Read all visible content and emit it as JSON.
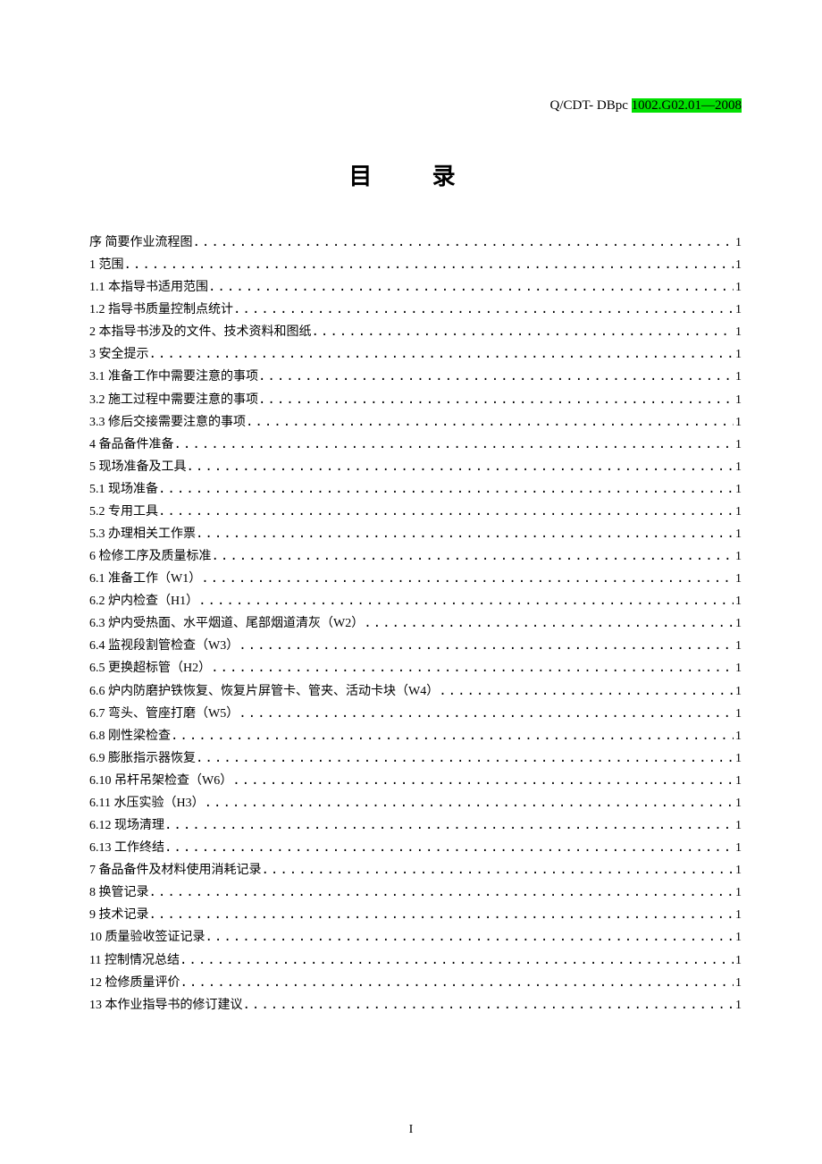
{
  "doc_code": {
    "prefix": "Q/CDT- DBpc ",
    "highlighted": "1002.G02.01—2008"
  },
  "title": "目 录",
  "page_number": "I",
  "toc": [
    {
      "label": "序  简要作业流程图",
      "page": "1"
    },
    {
      "label": "1 范围",
      "page": "1"
    },
    {
      "label": "1.1 本指导书适用范围",
      "page": "1"
    },
    {
      "label": "1.2 指导书质量控制点统计",
      "page": "1"
    },
    {
      "label": "2 本指导书涉及的文件、技术资料和图纸",
      "page": "1"
    },
    {
      "label": "3 安全提示",
      "page": "1"
    },
    {
      "label": "3.1 准备工作中需要注意的事项",
      "page": "1"
    },
    {
      "label": "3.2 施工过程中需要注意的事项",
      "page": "1"
    },
    {
      "label": "3.3 修后交接需要注意的事项",
      "page": "1"
    },
    {
      "label": "4 备品备件准备",
      "page": "1"
    },
    {
      "label": "5 现场准备及工具",
      "page": "1"
    },
    {
      "label": "5.1 现场准备",
      "page": "1"
    },
    {
      "label": "5.2 专用工具",
      "page": "1"
    },
    {
      "label": "5.3 办理相关工作票",
      "page": "1"
    },
    {
      "label": "6 检修工序及质量标准",
      "page": "1"
    },
    {
      "label": "6.1 准备工作（W1）",
      "page": "1"
    },
    {
      "label": "6.2 炉内检查（H1）",
      "page": "1"
    },
    {
      "label": "6.3 炉内受热面、水平烟道、尾部烟道清灰（W2）",
      "page": "1"
    },
    {
      "label": "6.4 监视段割管检查（W3）",
      "page": "1"
    },
    {
      "label": "6.5 更换超标管（H2）",
      "page": "1"
    },
    {
      "label": "6.6 炉内防磨护铁恢复、恢复片屏管卡、管夹、活动卡块（W4）",
      "page": "1"
    },
    {
      "label": "6.7 弯头、管座打磨（W5）",
      "page": "1"
    },
    {
      "label": "6.8 刚性梁检查",
      "page": "1"
    },
    {
      "label": "6.9 膨胀指示器恢复",
      "page": "1"
    },
    {
      "label": "6.10 吊杆吊架检查（W6）",
      "page": "1"
    },
    {
      "label": "6.11 水压实验（H3）",
      "page": "1"
    },
    {
      "label": "6.12 现场清理",
      "page": "1"
    },
    {
      "label": "6.13 工作终结",
      "page": "1"
    },
    {
      "label": "7 备品备件及材料使用消耗记录",
      "page": "1"
    },
    {
      "label": "8   换管记录",
      "page": "1"
    },
    {
      "label": "9 技术记录",
      "page": "1"
    },
    {
      "label": "10 质量验收签证记录",
      "page": "1"
    },
    {
      "label": "11 控制情况总结",
      "page": "1"
    },
    {
      "label": "12 检修质量评价",
      "page": "1"
    },
    {
      "label": "13 本作业指导书的修订建议",
      "page": "1"
    }
  ]
}
